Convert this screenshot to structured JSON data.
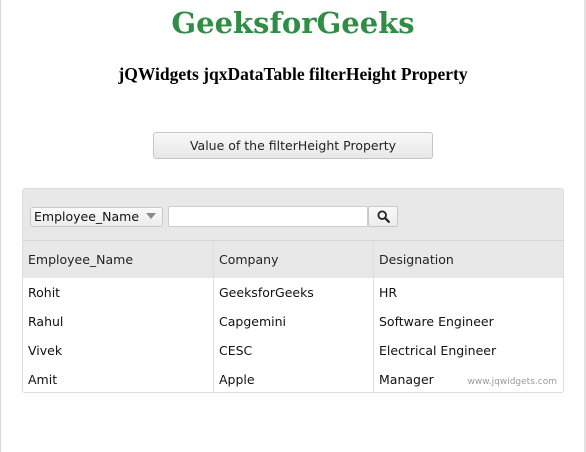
{
  "header": {
    "brand_title": "GeeksforGeeks",
    "subtitle": "jQWidgets jqxDataTable filterHeight Property"
  },
  "action_button": {
    "label": "Value of the filterHeight Property"
  },
  "data_table": {
    "filter": {
      "column_selected": "Employee_Name",
      "search_value": "",
      "search_button_icon": "search-icon"
    },
    "columns": [
      "Employee_Name",
      "Company",
      "Designation"
    ],
    "rows": [
      [
        "Rohit",
        "GeeksforGeeks",
        "HR"
      ],
      [
        "Rahul",
        "Capgemini",
        "Software Engineer"
      ],
      [
        "Vivek",
        "CESC",
        "Electrical Engineer"
      ],
      [
        "Amit",
        "Apple",
        "Manager"
      ]
    ],
    "watermark": "www.jqwidgets.com"
  }
}
